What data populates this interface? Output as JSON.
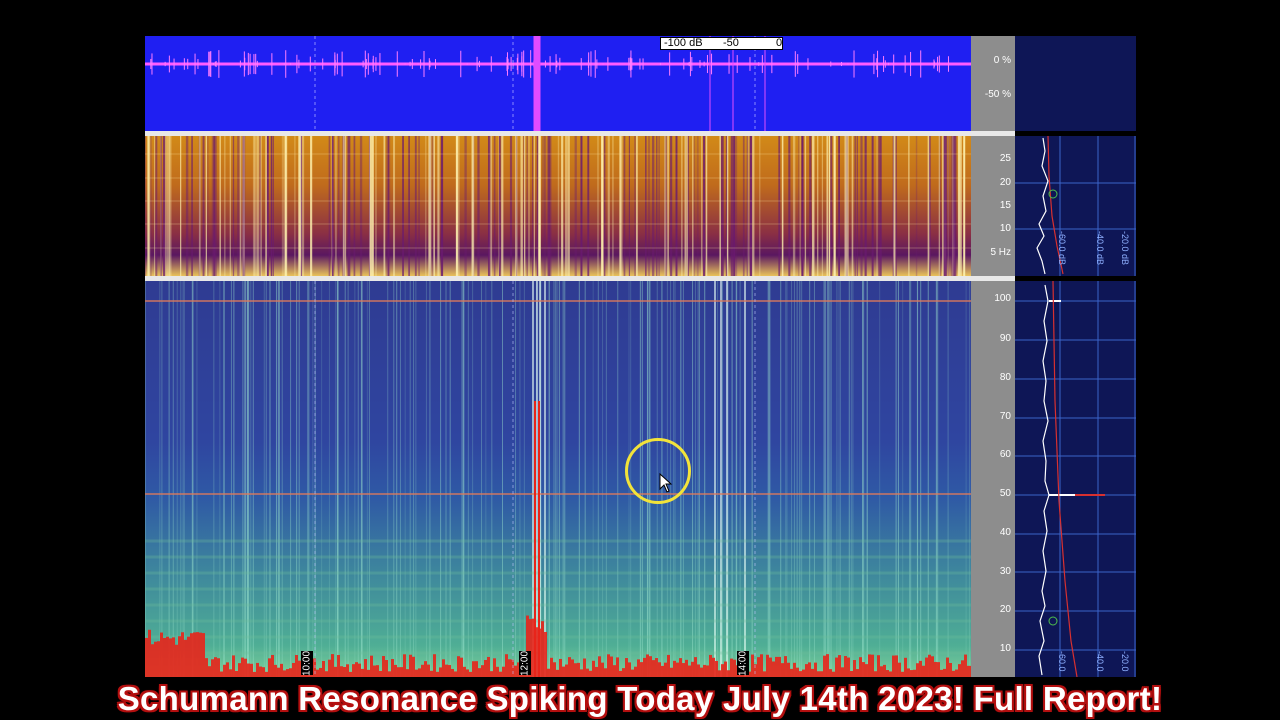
{
  "colorbar": {
    "min_label": "-100 dB",
    "mid_label": "-50",
    "max_label": "0"
  },
  "wave_scale": {
    "labels": [
      "0 %",
      "-50 %"
    ]
  },
  "mid_scale": {
    "labels": [
      "25",
      "20",
      "15",
      "10",
      "5 Hz"
    ]
  },
  "mid_right_axis": {
    "labels": [
      "-60.0 dB",
      "-40.0 dB",
      "-20.0 dB"
    ]
  },
  "bottom_scale": {
    "labels": [
      "100",
      "90",
      "80",
      "70",
      "60",
      "50",
      "40",
      "30",
      "20",
      "10"
    ]
  },
  "bottom_right_axis": {
    "labels": [
      "-60.0",
      "-40.0",
      "-20.0"
    ]
  },
  "time_markers": [
    "10:00",
    "12:00",
    "14:00"
  ],
  "title": "Schumann Resonance Spiking Today July 14th 2023! Full Report!",
  "colors": {
    "wave_bg": "#1f1ff2",
    "title_outline": "#b01010",
    "cursor_ring": "#f2e33a"
  }
}
